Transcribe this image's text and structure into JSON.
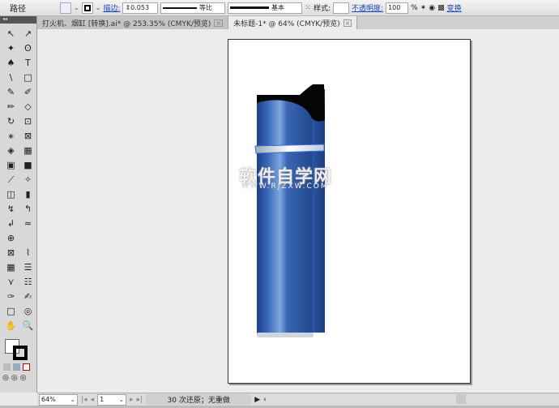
{
  "control": {
    "selection": "路径",
    "stroke_label": "描边:",
    "stroke_weight": "0.053",
    "profile": "等比",
    "brush": "基本",
    "style_label": "样式:",
    "opacity_label": "不透明度:",
    "opacity": "100",
    "percent": "%",
    "transform": "变换"
  },
  "tabs": [
    {
      "label": "打火机、烟缸 [转换].ai* @ 253.35% (CMYK/预览)",
      "active": false
    },
    {
      "label": "未标题-1* @ 64% (CMYK/预览)",
      "active": true
    }
  ],
  "tools": [
    "↖",
    "↗",
    "✦",
    "ʘ",
    "♠",
    "T",
    "\\",
    "□",
    "✎",
    "✐",
    "✏",
    "◇",
    "↻",
    "⊡",
    "⚹",
    "⊠",
    "◈",
    "▦",
    "▣",
    "■",
    "⟋",
    "✧",
    "◫",
    "▮",
    "↯",
    "↰",
    "↲",
    "≈",
    "⊕",
    "",
    "⊠",
    "⌇",
    "▦",
    "☰",
    "⋎",
    "☷",
    "✑",
    "✍",
    "□",
    "◎",
    "✋",
    "🔍"
  ],
  "watermark": {
    "title": "软件自学网",
    "url": "WWW.RJZXW.COM"
  },
  "status": {
    "zoom": "64%",
    "page": "1",
    "message": "30 次还原；无重做"
  },
  "colors": {
    "lighter_body": "#2f5aa8",
    "lighter_cap": "#000000"
  }
}
